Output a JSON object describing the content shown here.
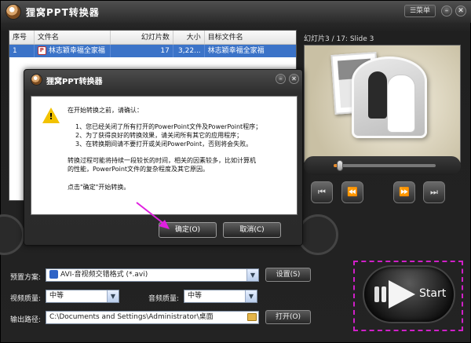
{
  "app": {
    "title": "狸窝PPT转换器",
    "menu_label": "菜单",
    "minimize_glyph": "–",
    "close_glyph": "✕"
  },
  "table": {
    "headers": [
      "序号",
      "文件名",
      "幻灯片数",
      "大小",
      "目标文件名"
    ],
    "rows": [
      {
        "index": "1",
        "filename": "林志颖幸福全家福",
        "slides": "17",
        "size": "3,22...",
        "target": "林志颖幸福全家福"
      }
    ]
  },
  "preview": {
    "label": "幻灯片3 / 17: Slide 3",
    "progress": 0.06,
    "controls": [
      "⏮",
      "⏪",
      "⏩",
      "⏭"
    ]
  },
  "settings": {
    "preset_label": "预置方案:",
    "preset_value": "AVI-音视频交错格式 (*.avi)",
    "settings_button": "设置(S)",
    "video_quality_label": "视频质量:",
    "video_quality_value": "中等",
    "audio_quality_label": "音频质量:",
    "audio_quality_value": "中等",
    "output_label": "输出路径:",
    "output_value": "C:\\Documents and Settings\\Administrator\\桌面",
    "open_button": "打开(O)",
    "start_label": "Start"
  },
  "dialog": {
    "title": "狸窝PPT转换器",
    "intro": "在开始转换之前，请确认：",
    "points": [
      "1、您已经关闭了所有打开的PowerPoint文件及PowerPoint程序；",
      "2、为了获得良好的转换效果，请关闭所有其它的应用程序；",
      "3、在转换期间请不要打开或关闭PowerPoint，否则将会失败。"
    ],
    "note_line1": "转换过程可能将持续一段较长的时间，相关的因素较多，比如计算机",
    "note_line2": "的性能，PowerPoint文件的复杂程度及其它原因。",
    "prompt": "点击\"确定\"开始转换。",
    "ok_button": "确定(O)",
    "cancel_button": "取消(C)"
  },
  "colors": {
    "accent": "#3b73c8",
    "highlight_box": "#d020c8",
    "pointer": "#e020e0",
    "warning": "#f2c200"
  }
}
